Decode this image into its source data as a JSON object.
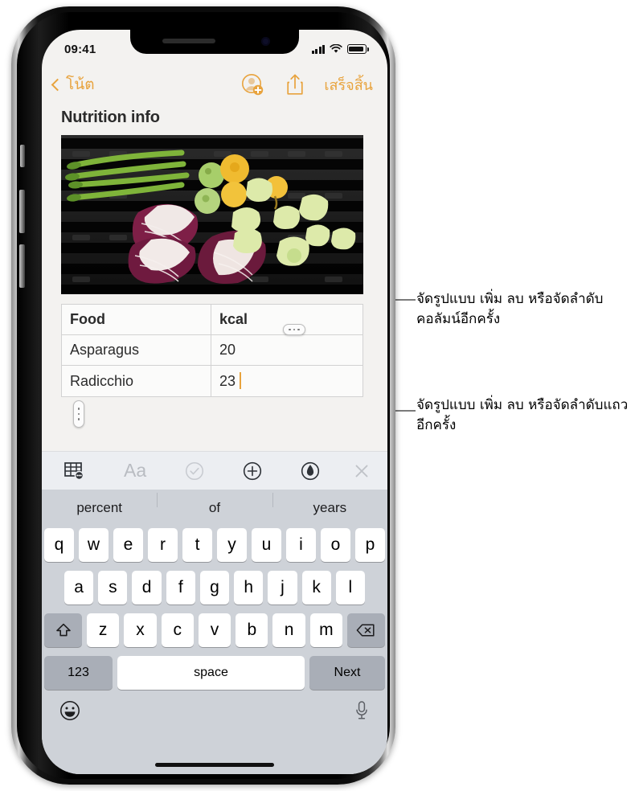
{
  "device": {
    "status_bar": {
      "time": "09:41",
      "cellular_icon": "signal-bars-icon",
      "wifi_icon": "wifi-icon",
      "battery_icon": "battery-full-icon"
    },
    "home_indicator": "home-indicator"
  },
  "navbar": {
    "back_label": "โน้ต",
    "back_icon": "chevron-left-icon",
    "add_people_icon": "add-person-icon",
    "share_icon": "share-icon",
    "done_label": "เสร็จสิ้น"
  },
  "note": {
    "title": "Nutrition info",
    "photo_alt": "grilled-vegetables-photo",
    "column_handle_icon": "column-handle-dots-icon",
    "row_handle_icon": "row-handle-dots-icon"
  },
  "table": {
    "columns": [
      "Food",
      "kcal"
    ],
    "rows": [
      [
        "Asparagus",
        "20"
      ],
      [
        "Radicchio",
        "23"
      ]
    ],
    "active_cell": {
      "row": 1,
      "col": 1,
      "caret": true
    }
  },
  "format_toolbar": {
    "items": [
      {
        "name": "table-button",
        "icon": "table-icon",
        "state": "active"
      },
      {
        "name": "text-format-button",
        "icon": "Aa-icon",
        "state": "disabled"
      },
      {
        "name": "checklist-button",
        "icon": "checkmark-circle-icon",
        "state": "disabled"
      },
      {
        "name": "add-attachment-button",
        "icon": "plus-circle-icon",
        "state": "enabled"
      },
      {
        "name": "markup-button",
        "icon": "pen-circle-icon",
        "state": "enabled"
      },
      {
        "name": "close-keyboard-button",
        "icon": "close-x-icon",
        "state": "disabled"
      }
    ]
  },
  "keyboard": {
    "predictions": [
      "percent",
      "of",
      "years"
    ],
    "row1": [
      "q",
      "w",
      "e",
      "r",
      "t",
      "y",
      "u",
      "i",
      "o",
      "p"
    ],
    "row2": [
      "a",
      "s",
      "d",
      "f",
      "g",
      "h",
      "j",
      "k",
      "l"
    ],
    "row3": [
      "z",
      "x",
      "c",
      "v",
      "b",
      "n",
      "m"
    ],
    "shift_icon": "shift-arrow-icon",
    "backspace_icon": "backspace-icon",
    "numbers_label": "123",
    "space_label": "space",
    "return_label": "Next",
    "emoji_icon": "emoji-smiley-icon",
    "dictation_icon": "microphone-icon"
  },
  "callouts": [
    {
      "name": "column-callout",
      "text": "จัดรูปแบบ เพิ่ม ลบ หรือจัดลำดับคอลัมน์อีกครั้ง"
    },
    {
      "name": "row-callout",
      "text": "จัดรูปแบบ เพิ่ม ลบ หรือจัดลำดับแถวอีกครั้ง"
    }
  ],
  "colors": {
    "accent": "#e8a33d",
    "keyboard_bg": "#ced2d8",
    "toolbar_bg": "#eceef2"
  }
}
